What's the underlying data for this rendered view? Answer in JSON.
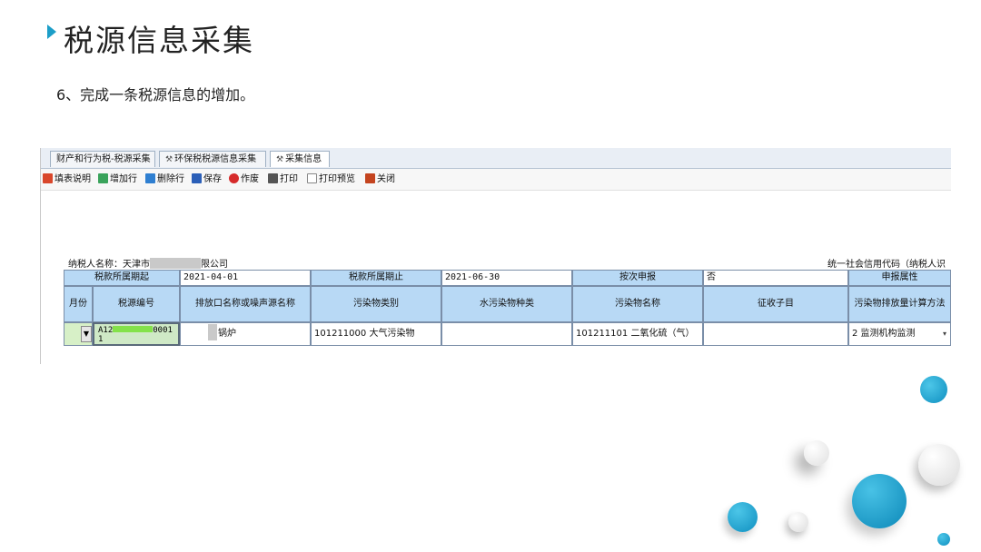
{
  "slide": {
    "title": "税源信息采集",
    "subtitle": "6、完成一条税源信息的增加。"
  },
  "tabs": [
    {
      "label": "财产和行为税-税源采集"
    },
    {
      "label": "环保税税源信息采集"
    },
    {
      "label": "采集信息",
      "active": true
    }
  ],
  "toolbar": {
    "items": [
      {
        "label": "填表说明",
        "icon": "form-help-icon",
        "color": "#d9472b"
      },
      {
        "label": "增加行",
        "icon": "add-row-icon",
        "color": "#3aa35b"
      },
      {
        "label": "删除行",
        "icon": "delete-row-icon",
        "color": "#2f7fd1"
      },
      {
        "label": "保存",
        "icon": "save-icon",
        "color": "#2b5fb8"
      },
      {
        "label": "作废",
        "icon": "void-icon",
        "color": "#d62b2b"
      },
      {
        "label": "打印",
        "icon": "print-icon",
        "color": "#444444"
      },
      {
        "label": "打印预览",
        "icon": "print-preview-icon",
        "color": "#888888"
      },
      {
        "label": "关闭",
        "icon": "close-icon",
        "color": "#c4441f"
      }
    ]
  },
  "taxpayer": {
    "name_label": "纳税人名称：天津市",
    "name_suffix": "限公司",
    "credit_code_label": "统一社会信用代码（纳税人识"
  },
  "table": {
    "period_start_label": "税款所属期起",
    "period_start_value": "2021-04-01",
    "period_end_label": "税款所属期止",
    "period_end_value": "2021-06-30",
    "per_time_label": "按次申报",
    "per_time_value": "否",
    "declare_attr_label": "申报属性",
    "columns": [
      "月份",
      "税源编号",
      "排放口名称或噪声源名称",
      "污染物类别",
      "水污染物种类",
      "污染物名称",
      "征收子目",
      "污染物排放量计算方法"
    ],
    "row": {
      "month": "",
      "source_code_prefix": "A12",
      "source_code_suffix": "0001",
      "source_code_line2": "1",
      "outlet_name": "锅炉",
      "pollutant_category": "101211000 大气污染物",
      "water_pollutant_type": "",
      "pollutant_name": "101211101 二氧化硫（气）",
      "levy_item": "",
      "calc_method": "2 监测机构监测"
    }
  },
  "colors": {
    "accent": "#1c9ec8",
    "header_bg": "#b8d9f5",
    "selected_cell": "#cfe9c6"
  }
}
